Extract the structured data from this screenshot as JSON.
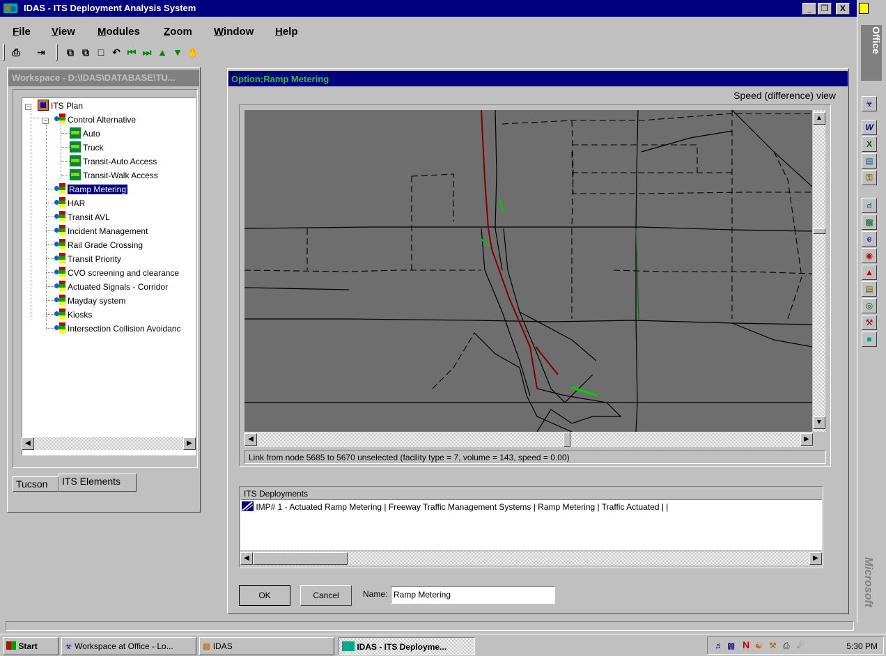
{
  "window": {
    "title": "IDAS - ITS Deployment Analysis System",
    "icon": "idas-app-icon",
    "controls": [
      "_",
      "❒",
      "X"
    ]
  },
  "menu": [
    {
      "label": "File"
    },
    {
      "label": "View"
    },
    {
      "label": "Modules"
    },
    {
      "label": "Zoom"
    },
    {
      "label": "Window"
    },
    {
      "label": "Help"
    }
  ],
  "toolbar_icons": [
    "print-icon",
    "exit-icon",
    "copy-icon",
    "paste-icon",
    "new-icon",
    "undo-icon",
    "first-icon",
    "last-icon",
    "up-icon",
    "down-icon",
    "pan-hand-icon"
  ],
  "workspace": {
    "title": "Workspace - D:\\IDAS\\DATABASE\\TU...",
    "tree": {
      "root": "ITS Plan",
      "control": "Control Alternative",
      "modes": [
        "Auto",
        "Truck",
        "Transit-Auto Access",
        "Transit-Walk Access"
      ],
      "options": [
        "Ramp Metering",
        "HAR",
        "Transit AVL",
        "Incident Management",
        "Rail Grade Crossing",
        "Transit Priority",
        "CVO screening and clearance",
        "Actuated Signals - Corridor",
        "Mayday system",
        "Kiosks",
        "Intersection Collision Avoidanc"
      ],
      "selected": "Ramp Metering"
    },
    "tabs": [
      "Tucson",
      "ITS Elements"
    ],
    "active_tab": "ITS Elements"
  },
  "option": {
    "title": "Option:Ramp Metering",
    "view_label": "Speed (difference) view",
    "status": "Link from node 5685 to 5670 unselected (facility type = 7, volume =   143, speed =  0.00)",
    "deployments_title": "ITS Deployments",
    "deployments": [
      "IMP#   1 - Actuated Ramp Metering | Freeway Traffic Management Systems | Ramp Metering | Traffic Actuated |  |"
    ],
    "ok_label": "OK",
    "cancel_label": "Cancel",
    "name_label": "Name:",
    "name_value": "Ramp Metering"
  },
  "map_colors": {
    "background": "#6e6e6e",
    "link": "#000000",
    "decrease": "#800000",
    "increase": "#00cc00"
  },
  "officebar": {
    "title": "Office",
    "brand": "Microsoft"
  },
  "taskbar": {
    "start": "Start",
    "tasks": [
      "Workspace at Office - Lo...",
      "IDAS",
      "IDAS - ITS Deployme..."
    ],
    "active_task": "IDAS - ITS Deployme...",
    "clock": "5:30 PM"
  }
}
